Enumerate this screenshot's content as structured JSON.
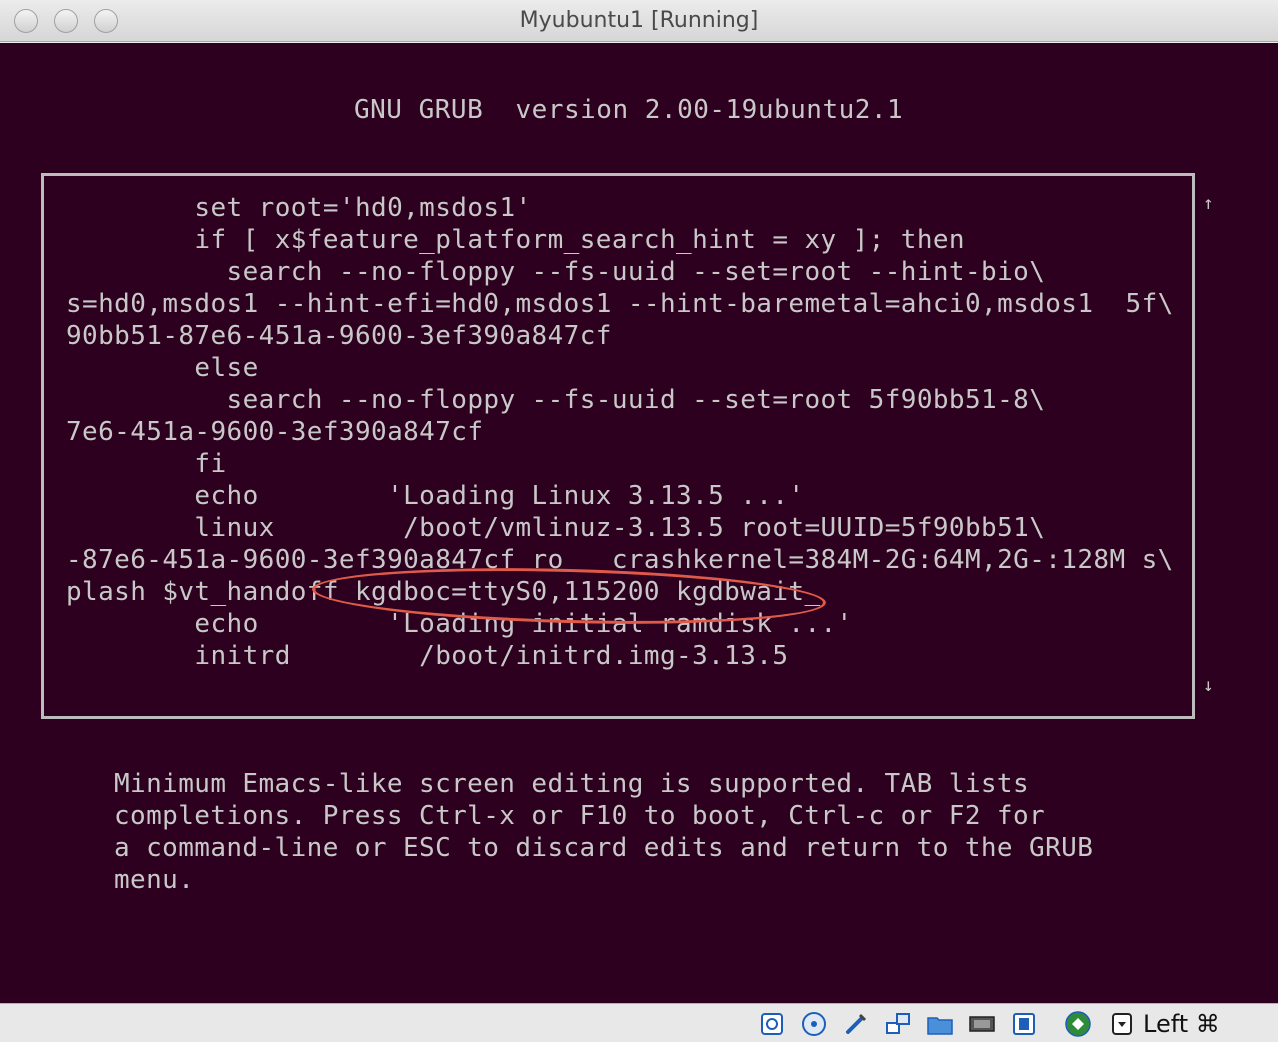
{
  "window": {
    "title": "Myubuntu1 [Running]"
  },
  "grub": {
    "header": "GNU GRUB  version 2.00-19ubuntu2.1",
    "script_lines": [
      "        set root='hd0,msdos1'",
      "        if [ x$feature_platform_search_hint = xy ]; then",
      "          search --no-floppy --fs-uuid --set=root --hint-bio\\",
      "s=hd0,msdos1 --hint-efi=hd0,msdos1 --hint-baremetal=ahci0,msdos1  5f\\",
      "90bb51-87e6-451a-9600-3ef390a847cf",
      "        else",
      "          search --no-floppy --fs-uuid --set=root 5f90bb51-8\\",
      "7e6-451a-9600-3ef390a847cf",
      "        fi",
      "        echo        'Loading Linux 3.13.5 ...'",
      "        linux        /boot/vmlinuz-3.13.5 root=UUID=5f90bb51\\",
      "-87e6-451a-9600-3ef390a847cf ro   crashkernel=384M-2G:64M,2G-:128M s\\",
      "plash $vt_handoff kgdboc=ttyS0,115200 kgdbwait_",
      "        echo        'Loading initial ramdisk ...'",
      "        initrd        /boot/initrd.img-3.13.5"
    ],
    "scroll_up_glyph": "↑",
    "scroll_down_glyph": "↓",
    "help_lines": [
      "Minimum Emacs-like screen editing is supported. TAB lists",
      "completions. Press Ctrl-x or F10 to boot, Ctrl-c or F2 for",
      "a command-line or ESC to discard edits and return to the GRUB",
      "menu."
    ],
    "colors": {
      "background": "#2c001e",
      "text": "#c8c8c8",
      "highlight": "#e05a4a"
    }
  },
  "statusbar": {
    "icons": [
      "hard-disk-icon",
      "optical-drive-icon",
      "usb-icon",
      "network-icon",
      "shared-folder-icon",
      "display-icon",
      "video-capture-icon",
      "guest-additions-icon",
      "mouse-integration-icon"
    ],
    "host_key": "Left ⌘"
  }
}
